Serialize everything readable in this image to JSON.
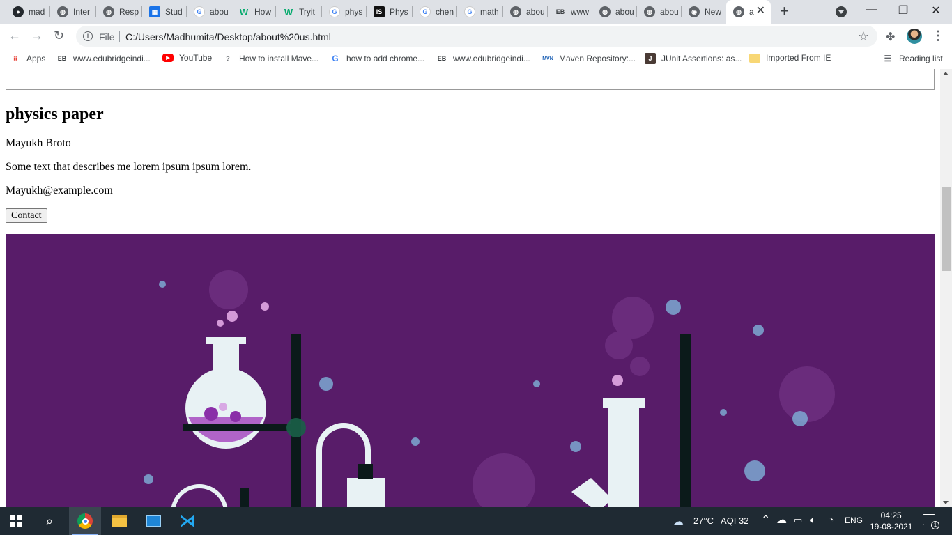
{
  "tabs": [
    {
      "label": "mad",
      "icon": "github-icon"
    },
    {
      "label": "Inter",
      "icon": "globe-icon"
    },
    {
      "label": "Resp",
      "icon": "globe-icon"
    },
    {
      "label": "Stud",
      "icon": "grid-icon"
    },
    {
      "label": "abou",
      "icon": "google-icon"
    },
    {
      "label": "How",
      "icon": "w3schools-icon"
    },
    {
      "label": "Tryit",
      "icon": "w3schools-icon"
    },
    {
      "label": "phys",
      "icon": "google-icon"
    },
    {
      "label": "Phys",
      "icon": "is-icon"
    },
    {
      "label": "chen",
      "icon": "google-icon"
    },
    {
      "label": "math",
      "icon": "google-icon"
    },
    {
      "label": "abou",
      "icon": "globe-icon"
    },
    {
      "label": "www",
      "icon": "edubridge-icon"
    },
    {
      "label": "abou",
      "icon": "globe-icon"
    },
    {
      "label": "abou",
      "icon": "globe-icon"
    },
    {
      "label": "New",
      "icon": "chrome-icon"
    },
    {
      "label": "a",
      "icon": "globe-icon",
      "active": true
    }
  ],
  "omnibox": {
    "scheme_label": "File",
    "url": "C:/Users/Madhumita/Desktop/about%20us.html"
  },
  "bookmarks": [
    {
      "label": "Apps",
      "icon": "apps-grid-icon"
    },
    {
      "label": "www.edubridgeindi...",
      "icon": "edubridge-icon"
    },
    {
      "label": "YouTube",
      "icon": "youtube-icon"
    },
    {
      "label": "How to install Mave...",
      "icon": "question-icon"
    },
    {
      "label": "how to add chrome...",
      "icon": "google-icon"
    },
    {
      "label": "www.edubridgeindi...",
      "icon": "edubridge-icon"
    },
    {
      "label": "Maven Repository:...",
      "icon": "mvn-icon"
    },
    {
      "label": "JUnit Assertions: as...",
      "icon": "junit-icon"
    },
    {
      "label": "Imported From IE",
      "icon": "folder-icon"
    },
    {
      "label": "Reading list",
      "icon": "reading-list-icon"
    }
  ],
  "page": {
    "heading": "physics paper",
    "name": "Mayukh Broto",
    "description": "Some text that describes me lorem ipsum ipsum lorem.",
    "email": "Mayukh@example.com",
    "contact_label": "Contact"
  },
  "taskbar": {
    "weather": "27°C",
    "aqi": "AQI 32",
    "language": "ENG",
    "time": "04:25",
    "date": "19-08-2021",
    "notifications": "1"
  },
  "colors": {
    "lab_background": "#581c69",
    "tab_strip": "#dee1e6",
    "taskbar": "#1f2a33"
  }
}
